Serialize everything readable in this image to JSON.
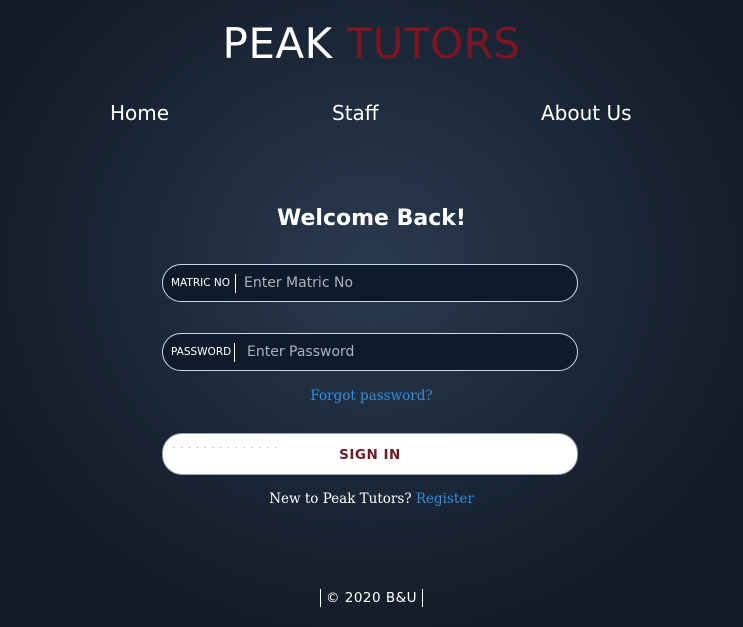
{
  "brand": {
    "first": "PEAK",
    "second": "TUTORS"
  },
  "nav": {
    "home": "Home",
    "staff": "Staff",
    "about": "About Us"
  },
  "login": {
    "heading": "Welcome Back!",
    "matric": {
      "label": "MATRIC NO",
      "placeholder": "Enter Matric No",
      "value": ""
    },
    "password": {
      "label": "PASSWORD",
      "placeholder": "Enter Password",
      "value": ""
    },
    "forgot": "Forgot password?",
    "signin": "SIGN IN",
    "register_prompt": "New to Peak Tutors?",
    "register_link": "Register"
  },
  "footer": {
    "text": "© 2020 B&U"
  },
  "colors": {
    "accent": "#7b1622",
    "link": "#2f8fe0",
    "background": "#1f2c3d"
  }
}
